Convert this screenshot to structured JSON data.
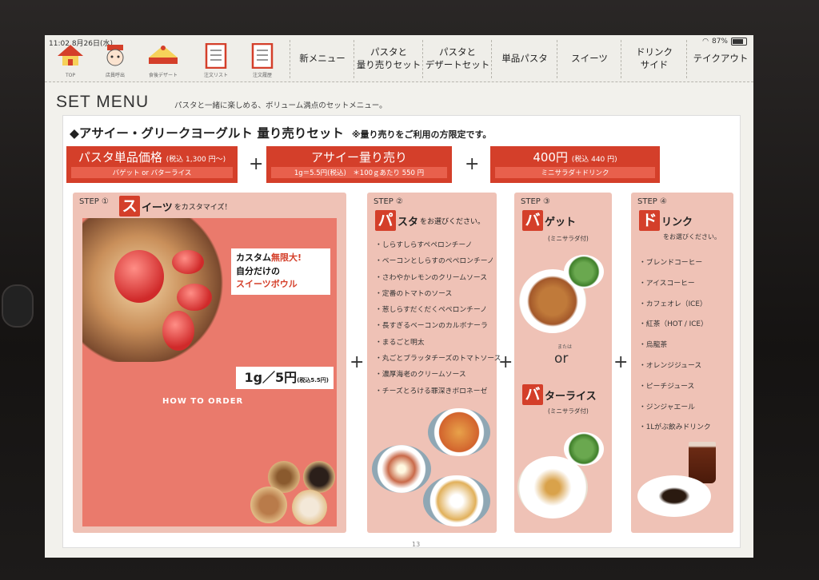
{
  "status": {
    "time": "11:02",
    "date": "8月26日(水)",
    "battery": "87%"
  },
  "icons": [
    {
      "name": "home-icon",
      "label": "TOP"
    },
    {
      "name": "call-staff-icon",
      "label": "店員呼出"
    },
    {
      "name": "dessert-icon",
      "label": "食後デザート"
    },
    {
      "name": "order-list-icon",
      "label": "注文リスト"
    },
    {
      "name": "order-history-icon",
      "label": "注文履歴"
    }
  ],
  "tabs": [
    {
      "label": "新メニュー"
    },
    {
      "label": "パスタと\n量り売りセット"
    },
    {
      "label": "パスタと\nデザートセット"
    },
    {
      "label": "単品パスタ"
    },
    {
      "label": "スイーツ"
    },
    {
      "label": "ドリンク\nサイド"
    },
    {
      "label": "テイクアウト"
    }
  ],
  "page": {
    "title": "SET MENU",
    "subtitle": "パスタと一緒に楽しめる、ボリューム満点のセットメニュー。",
    "heading": "◆アサイー・グリークヨーグルト 量り売りセット",
    "heading_note": "※量り売りをご利用の方限定です。",
    "page_number": "13"
  },
  "price_boxes": [
    {
      "main": "パスタ単品価格",
      "tax": "(税込 1,300 円〜)",
      "sub": "バゲット or バターライス"
    },
    {
      "main": "アサイー量り売り",
      "tax": "",
      "sub": "1g＝5.5円(税込)　＊100ｇあたり 550 円"
    },
    {
      "main": "400円",
      "tax": "(税込 440 円)",
      "sub": "ミニサラダ＋ドリンク"
    }
  ],
  "plus": "+",
  "step1": {
    "label": "STEP ①",
    "char": "ス",
    "rest": "イーツ",
    "small": "をカスタマイズ！",
    "custom_lines": [
      "カスタム",
      "無限大!",
      "自分だけの",
      "スイーツボウル"
    ],
    "how_to_order": "HOW TO ORDER",
    "price": "1g／5円",
    "price_tax": "(税込5.5円)"
  },
  "step2": {
    "label": "STEP ②",
    "char": "パ",
    "rest": "スタ",
    "small": "をお選びください。",
    "items": [
      "・しらすしらすペペロンチーノ",
      "・ベーコンとしらすのペペロンチーノ",
      "・さわやかレモンのクリームソース",
      "・定番のトマトのソース",
      "・葱しらすだくだくペペロンチーノ",
      "・長すぎるベーコンのカルボナーラ",
      "・まるごと明太",
      "・丸ごとブラッタチーズのトマトソース",
      "・濃厚海老のクリームソース",
      "・チーズとろける罪深きボロネーゼ"
    ]
  },
  "step3": {
    "label": "STEP ③",
    "opt1_char": "バ",
    "opt1_rest": "ゲット",
    "opt1_note": "(ミニサラダ付)",
    "or_small": "または",
    "or": "or",
    "opt2_char": "バ",
    "opt2_rest": "ターライス",
    "opt2_note": "(ミニサラダ付)"
  },
  "step4": {
    "label": "STEP ④",
    "char": "ド",
    "rest": "リンク",
    "small": "をお選びください。",
    "items": [
      "・ブレンドコーヒー",
      "・アイスコーヒー",
      "・カフェオレ（ICE）",
      "・紅茶（HOT / ICE）",
      "・烏龍茶",
      "・オレンジジュース",
      "・ピーチジュース",
      "・ジンジャエール",
      "・1Lがぶ飲みドリンク"
    ]
  },
  "colors": {
    "accent": "#d43f2a",
    "step_bg": "#efc2b6",
    "sweets_bg": "#ea7a6c"
  }
}
